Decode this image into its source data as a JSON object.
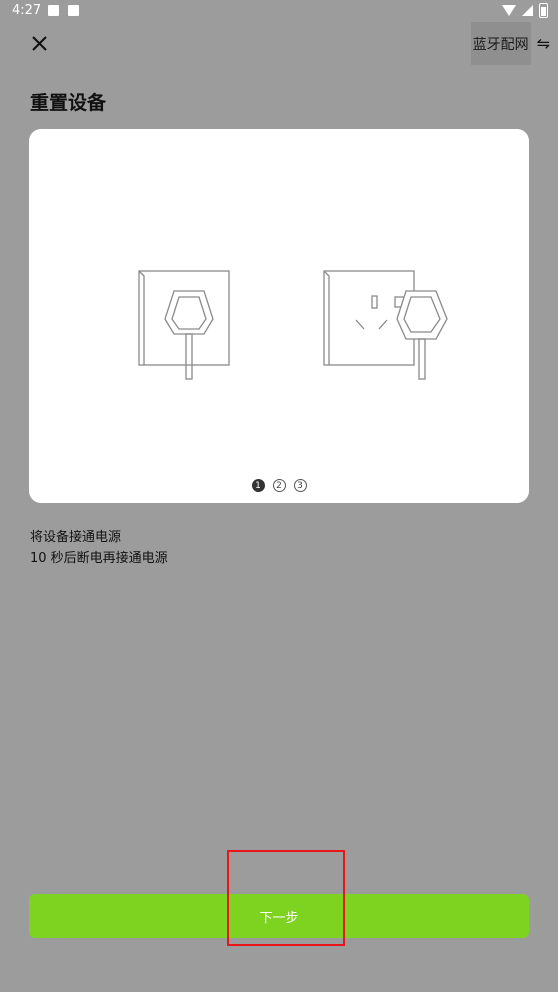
{
  "status_bar": {
    "time": "4:27"
  },
  "header": {
    "close_icon": "close-icon",
    "switch_label": "蓝牙配网",
    "switch_icon": "⇋"
  },
  "page": {
    "title": "重置设备"
  },
  "carousel": {
    "pages": [
      "1",
      "2",
      "3"
    ],
    "active_index": 0
  },
  "instructions": {
    "line1": "将设备接通电源",
    "line2": "10 秒后断电再接通电源"
  },
  "footer": {
    "next_label": "下一步"
  },
  "colors": {
    "background": "#9c9c9c",
    "accent": "#7ed321",
    "highlight": "#e8151b"
  }
}
